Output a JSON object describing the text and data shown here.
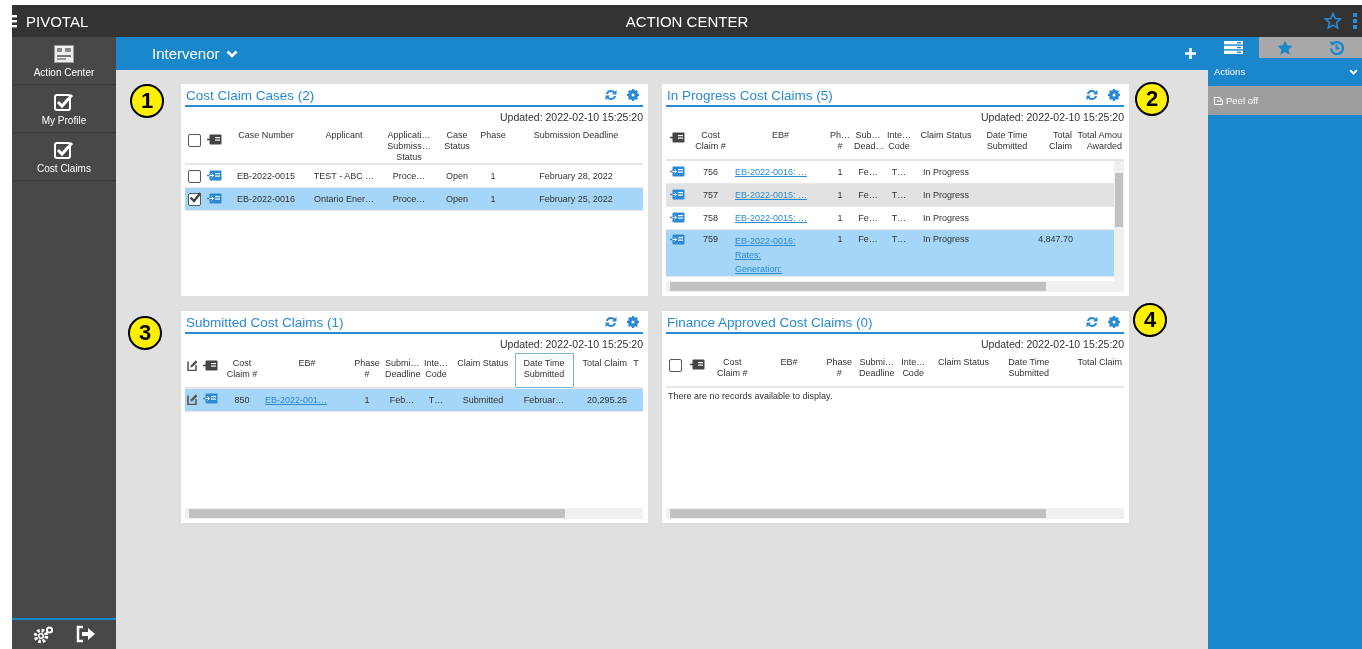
{
  "topbar": {
    "brand": "PIVOTAL",
    "title": "ACTION CENTER"
  },
  "sidebar": {
    "items": [
      {
        "label": "Action Center",
        "kind": "board"
      },
      {
        "label": "My Profile",
        "kind": "check"
      },
      {
        "label": "Cost Claims",
        "kind": "check"
      }
    ]
  },
  "context": {
    "label": "Intervenor"
  },
  "right_panel": {
    "tabs": [
      {
        "kind": "list",
        "selected": true
      },
      {
        "kind": "star",
        "selected": false
      },
      {
        "kind": "history",
        "selected": false
      }
    ],
    "section": {
      "title": "Actions",
      "expanded": true
    },
    "actions": [
      {
        "label": "Peel off"
      }
    ]
  },
  "callouts": [
    "1",
    "2",
    "3",
    "4"
  ],
  "widgets": [
    {
      "title": "Cost Claim Cases (2)",
      "updated": "Updated: 2022-02-10 15:25:20",
      "checkboxes": true,
      "edit_icons": false,
      "header_checked": false,
      "h_scroll": false,
      "v_scroll": false,
      "columns": [
        {
          "label": [
            "Case Number"
          ],
          "kind": "text"
        },
        {
          "label": [
            "Applicant"
          ],
          "kind": "text"
        },
        {
          "label": [
            "Applicati…",
            "Submiss…",
            "Status"
          ],
          "kind": "text"
        },
        {
          "label": [
            "Case",
            "Status"
          ],
          "kind": "text"
        },
        {
          "label": [
            "Phase"
          ],
          "kind": "text"
        },
        {
          "label": [
            "Submission Deadline"
          ],
          "kind": "text"
        }
      ],
      "rows": [
        {
          "selected": false,
          "checked": false,
          "cells": [
            "EB-2022-0015",
            "TEST - ABC …",
            "Proce…",
            "Open",
            "1",
            "February 28, 2022"
          ]
        },
        {
          "selected": true,
          "checked": true,
          "cells": [
            "EB-2022-0016",
            "Ontario Ener…",
            "Proce…",
            "Open",
            "1",
            "February 25, 2022"
          ]
        }
      ]
    },
    {
      "title": "In Progress Cost Claims (5)",
      "updated": "Updated: 2022-02-10 15:25:20",
      "checkboxes": false,
      "edit_icons": false,
      "h_scroll": true,
      "v_scroll": true,
      "columns": [
        {
          "label": [
            "Cost",
            "Claim #"
          ],
          "kind": "text"
        },
        {
          "label": [
            "EB#"
          ],
          "kind": "link"
        },
        {
          "label": [
            "Ph…",
            "#"
          ],
          "kind": "text"
        },
        {
          "label": [
            "Sub…",
            "Dead…"
          ],
          "kind": "text"
        },
        {
          "label": [
            "Inte…",
            "Code"
          ],
          "kind": "text"
        },
        {
          "label": [
            "Claim Status"
          ],
          "kind": "text"
        },
        {
          "label": [
            "Date Time",
            "Submitted"
          ],
          "kind": "text"
        },
        {
          "label": [
            "Total",
            "Claim"
          ],
          "kind": "amount"
        },
        {
          "label": [
            "Total Amou",
            "Awarded"
          ],
          "kind": "amount"
        }
      ],
      "rows": [
        {
          "selected": false,
          "hovered": false,
          "cells": [
            "756",
            "EB-2022-0016: …",
            "1",
            "Fe…",
            "T…",
            "In Progress",
            null,
            null,
            null
          ]
        },
        {
          "selected": false,
          "hovered": true,
          "cells": [
            "757",
            "EB-2022-0015: …",
            "1",
            "Fe…",
            "T…",
            "In Progress",
            null,
            null,
            null
          ]
        },
        {
          "selected": false,
          "hovered": false,
          "cells": [
            "758",
            "EB-2022-0015: …",
            "1",
            "Fe…",
            "T…",
            "In Progress",
            null,
            null,
            null
          ]
        },
        {
          "selected": true,
          "hovered": false,
          "cells": [
            "759",
            [
              "EB-2022-0016:",
              "Rates:",
              "Generation:"
            ],
            "1",
            "Fe…",
            "T…",
            "In Progress",
            null,
            "4,847.70",
            null
          ]
        }
      ]
    },
    {
      "title": "Submitted Cost Claims (1)",
      "updated": "Updated: 2022-02-10 15:25:20",
      "checkboxes": false,
      "edit_icons": true,
      "h_scroll": true,
      "v_scroll": false,
      "columns": [
        {
          "label": [
            "Cost",
            "Claim #"
          ],
          "kind": "text",
          "focused": false
        },
        {
          "label": [
            "EB#"
          ],
          "kind": "link",
          "focused": false
        },
        {
          "label": [
            "Phase",
            "#"
          ],
          "kind": "text",
          "focused": false
        },
        {
          "label": [
            "Submi…",
            "Deadline"
          ],
          "kind": "text",
          "focused": false
        },
        {
          "label": [
            "Inte…",
            "Code"
          ],
          "kind": "text",
          "focused": false
        },
        {
          "label": [
            "Claim Status"
          ],
          "kind": "text",
          "focused": false
        },
        {
          "label": [
            "Date Time",
            "Submitted"
          ],
          "kind": "text",
          "focused": true
        },
        {
          "label": [
            "Total Claim"
          ],
          "kind": "amount",
          "focused": false
        },
        {
          "label": [
            "T"
          ],
          "kind": "text",
          "focused": false
        }
      ],
      "rows": [
        {
          "selected": true,
          "cells": [
            "850",
            "EB-2022-001…",
            "1",
            "Feb…",
            "T…",
            "Submitted",
            "Februar…",
            "20,295.25",
            null
          ]
        }
      ]
    },
    {
      "title": "Finance Approved Cost Claims (0)",
      "updated": "Updated: 2022-02-10 15:25:20",
      "checkboxes": true,
      "edit_icons": false,
      "header_checked": false,
      "h_scroll": true,
      "v_scroll": false,
      "columns": [
        {
          "label": [
            "Cost",
            "Claim #"
          ],
          "kind": "text"
        },
        {
          "label": [
            "EB#"
          ],
          "kind": "link"
        },
        {
          "label": [
            "Phase",
            "#"
          ],
          "kind": "text"
        },
        {
          "label": [
            "Submi…",
            "Deadline"
          ],
          "kind": "text"
        },
        {
          "label": [
            "Inte…",
            "Code"
          ],
          "kind": "text"
        },
        {
          "label": [
            "Claim Status"
          ],
          "kind": "text"
        },
        {
          "label": [
            "Date Time",
            "Submitted"
          ],
          "kind": "text"
        },
        {
          "label": [
            "Total Claim"
          ],
          "kind": "amount"
        }
      ],
      "empty_message": "There are no records available to display."
    }
  ]
}
